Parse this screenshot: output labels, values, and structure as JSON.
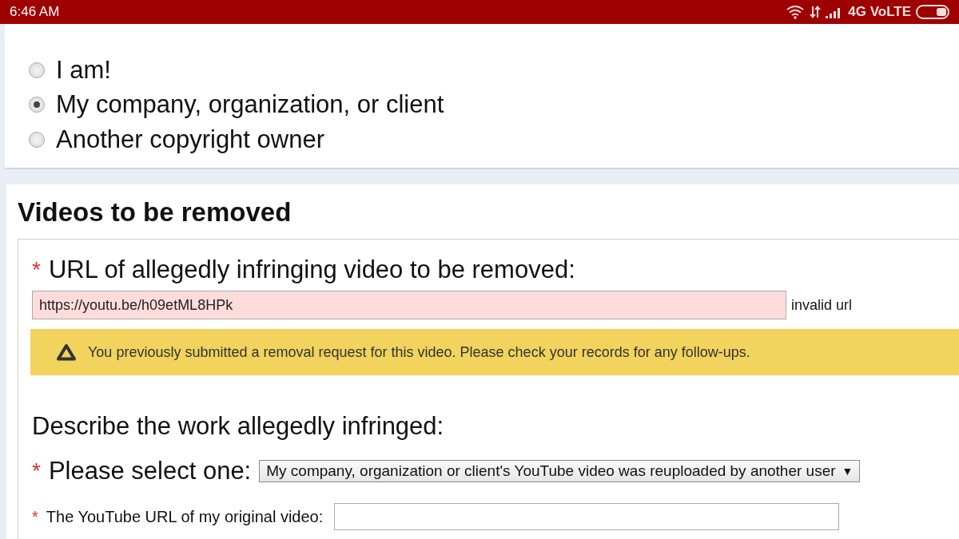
{
  "status_bar": {
    "time": "6:46 AM",
    "network": "4G VoLTE"
  },
  "affected": {
    "options": [
      {
        "label": "I am!",
        "selected": false
      },
      {
        "label": "My company, organization, or client",
        "selected": true
      },
      {
        "label": "Another copyright owner",
        "selected": false
      }
    ]
  },
  "videos": {
    "title": "Videos to be removed",
    "url_field": {
      "required_mark": "*",
      "label": "URL of allegedly infringing video to be removed:",
      "value": "https://youtu.be/h09etML8HPk",
      "invalid": true,
      "error": "invalid url"
    },
    "warning": "You previously submitted a removal request for this video. Please check your records for any follow-ups.",
    "describe_heading": "Describe the work allegedly infringed:",
    "select": {
      "required_mark": "*",
      "label": "Please select one:",
      "value": "My company, organization or client's YouTube video was reuploaded by another user",
      "caret": "▼"
    },
    "original_url": {
      "required_mark": "*",
      "label": "The YouTube URL of my original video:"
    }
  }
}
